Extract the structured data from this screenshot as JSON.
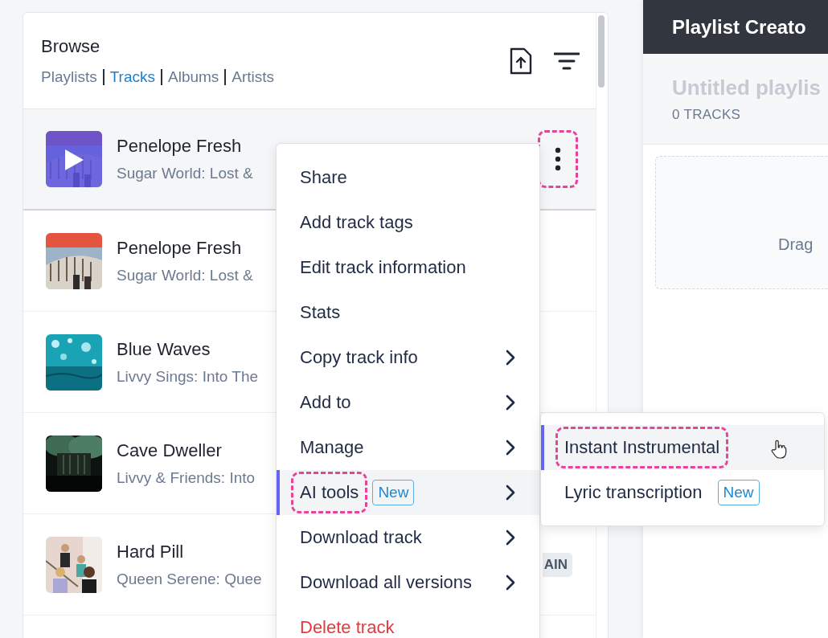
{
  "browse": {
    "title": "Browse",
    "tabs": [
      {
        "label": "Playlists",
        "selected": false
      },
      {
        "label": "Tracks",
        "selected": true
      },
      {
        "label": "Albums",
        "selected": false
      },
      {
        "label": "Artists",
        "selected": false
      }
    ],
    "tracks": [
      {
        "title": "Penelope Fresh",
        "subtitle": "Sugar World: Lost &",
        "selected": true,
        "menu_button": {
          "highlighted": true
        }
      },
      {
        "title": "Penelope Fresh",
        "subtitle": "Sugar World: Lost &",
        "selected": false
      },
      {
        "title": "Blue Waves",
        "subtitle": "Livvy Sings: Into The",
        "selected": false
      },
      {
        "title": "Cave Dweller",
        "subtitle": "Livvy & Friends: Into",
        "selected": false
      },
      {
        "title": "Hard Pill",
        "subtitle": "Queen Serene: Quee",
        "selected": false,
        "badge": "AIN"
      }
    ]
  },
  "context_menu": {
    "items": [
      {
        "label": "Share",
        "kind": "plain",
        "selected": false,
        "highlighted": false
      },
      {
        "label": "Add track tags",
        "kind": "plain",
        "selected": false,
        "highlighted": false
      },
      {
        "label": "Edit track information",
        "kind": "plain",
        "selected": false,
        "highlighted": false
      },
      {
        "label": "Stats",
        "kind": "plain",
        "selected": false,
        "highlighted": false
      },
      {
        "label": "Copy track info",
        "kind": "submenu",
        "selected": false,
        "highlighted": false
      },
      {
        "label": "Add to",
        "kind": "submenu",
        "selected": false,
        "highlighted": false
      },
      {
        "label": "Manage",
        "kind": "submenu",
        "selected": false,
        "highlighted": false
      },
      {
        "label": "AI tools",
        "kind": "submenu",
        "selected": true,
        "highlighted": true,
        "badge": "New"
      },
      {
        "label": "Download track",
        "kind": "submenu",
        "selected": false,
        "highlighted": false
      },
      {
        "label": "Download all versions",
        "kind": "submenu",
        "selected": false,
        "highlighted": false
      },
      {
        "label": "Delete track",
        "kind": "danger",
        "selected": false,
        "highlighted": false
      }
    ]
  },
  "submenu": {
    "items": [
      {
        "label": "Instant Instrumental",
        "selected": true,
        "highlighted": true
      },
      {
        "label": "Lyric transcription",
        "selected": false,
        "highlighted": false,
        "badge": "New"
      }
    ]
  },
  "playlist_creator": {
    "title": "Playlist Creato",
    "playlist_name": "Untitled playlis",
    "track_count": "0 TRACKS",
    "dropzone_text": "Drag"
  }
}
